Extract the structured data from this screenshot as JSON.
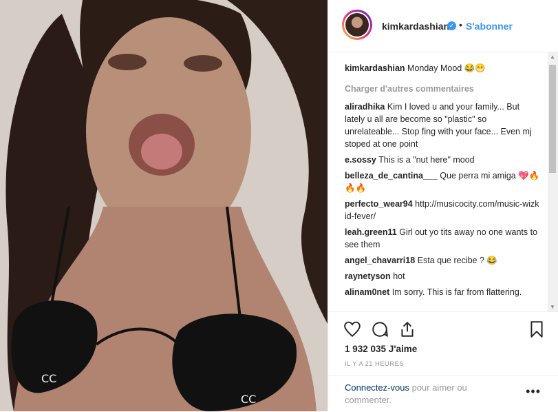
{
  "post": {
    "username": "kimkardashian",
    "verified_icon": "verified-badge-icon",
    "separator": "•",
    "follow_label": "S'abonner"
  },
  "caption": {
    "username": "kimkardashian",
    "text": "Monday Mood 😂😁"
  },
  "load_more_label": "Charger d'autres commentaires",
  "comments": [
    {
      "user": "aliradhika",
      "text": "Kim I loved u and your family... But lately u all are become so \"plastic\" so unrelateable... Stop fing with your face... Even mj stoped at one point"
    },
    {
      "user": "e.sossy",
      "text": "This is a \"nut here\" mood"
    },
    {
      "user": "belleza_de_cantina___",
      "text": "Que perra mi amiga 💖🔥🔥🔥"
    },
    {
      "user": "perfecto_wear94",
      "text": "http://musicocity.com/music-wizkid-fever/"
    },
    {
      "user": "leah.green11",
      "text": "Girl out yo tits away no one wants to see them"
    },
    {
      "user": "angel_chavarri18",
      "text": "Esta que recibe ? 😂"
    },
    {
      "user": "raynetyson",
      "text": "hot"
    },
    {
      "user": "alinam0net",
      "text": "Im sorry. This is far from flattering."
    }
  ],
  "likes_label": "1 932 035 J'aime",
  "timestamp": "IL Y A 21 HEURES",
  "login": {
    "link": "Connectez-vous",
    "text": " pour aimer ou commenter."
  },
  "more_options": "•••",
  "icons": [
    "heart-icon",
    "comment-icon",
    "share-icon",
    "bookmark-icon"
  ],
  "colors": {
    "link": "#3897f0",
    "muted": "#999999",
    "text": "#262626"
  }
}
